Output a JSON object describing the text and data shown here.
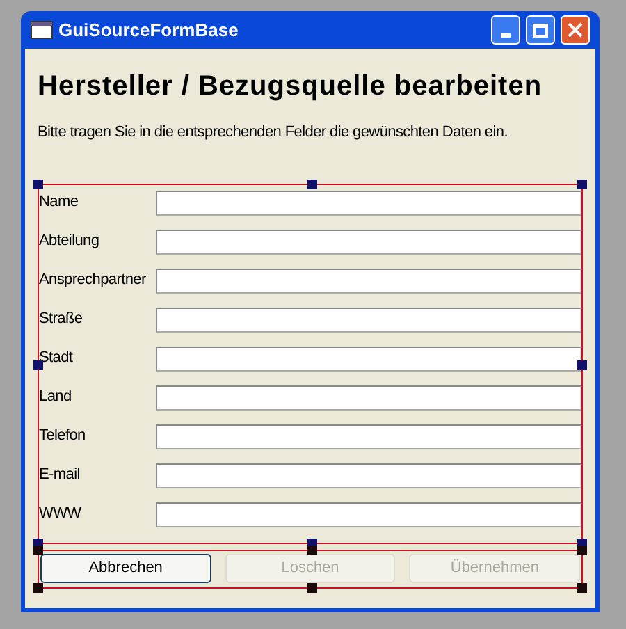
{
  "window": {
    "title": "GuiSourceFormBase"
  },
  "heading": "Hersteller / Bezugsquelle bearbeiten",
  "instructions": "Bitte tragen Sie in die entsprechenden Felder die gewünschten Daten ein.",
  "fields": [
    {
      "label": "Name"
    },
    {
      "label": "Abteilung"
    },
    {
      "label": "Ansprechpartner"
    },
    {
      "label": "Straße"
    },
    {
      "label": "Stadt"
    },
    {
      "label": "Land"
    },
    {
      "label": "Telefon"
    },
    {
      "label": "E-mail"
    },
    {
      "label": "WWW"
    }
  ],
  "buttons": [
    {
      "label": "Abbrechen",
      "disabled": false
    },
    {
      "label": "Loschen",
      "disabled": true
    },
    {
      "label": "Übernehmen",
      "disabled": true
    }
  ]
}
